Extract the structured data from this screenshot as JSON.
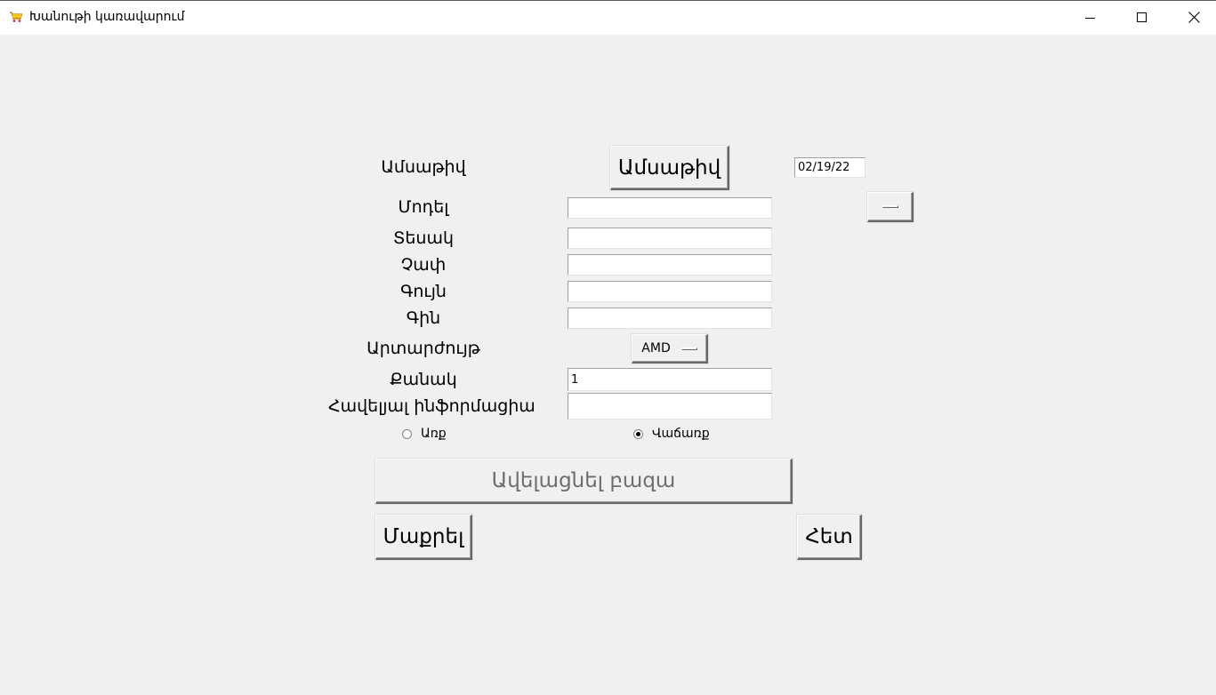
{
  "window": {
    "title": "Խանութի կառավարում",
    "app_icon": "cart-icon",
    "controls": [
      "minimize-icon",
      "maximize-icon",
      "close-icon"
    ]
  },
  "form": {
    "date_label": "Ամսաթիվ",
    "date_button": "Ամսաթիվ",
    "date_value": "02/19/22",
    "model_label": "Մոդել",
    "model_value": "",
    "type_label": "Տեսակ",
    "type_value": "",
    "size_label": "Չափ",
    "size_value": "",
    "color_label": "Գույն",
    "color_value": "",
    "price_label": "Գին",
    "price_value": "",
    "currency_label": "Արտարժույթ",
    "currency_value": "AMD",
    "quantity_label": "Քանակ",
    "quantity_value": "1",
    "extra_label": "Հավելյալ ինֆորմացիա",
    "extra_value": "",
    "radio_buy": "Առք",
    "radio_sell": "Վաճառք",
    "selected_radio": "sell"
  },
  "buttons": {
    "add_to_db": "Ավելացնել բազա",
    "clear": "Մաքրել",
    "back": "Հետ"
  }
}
